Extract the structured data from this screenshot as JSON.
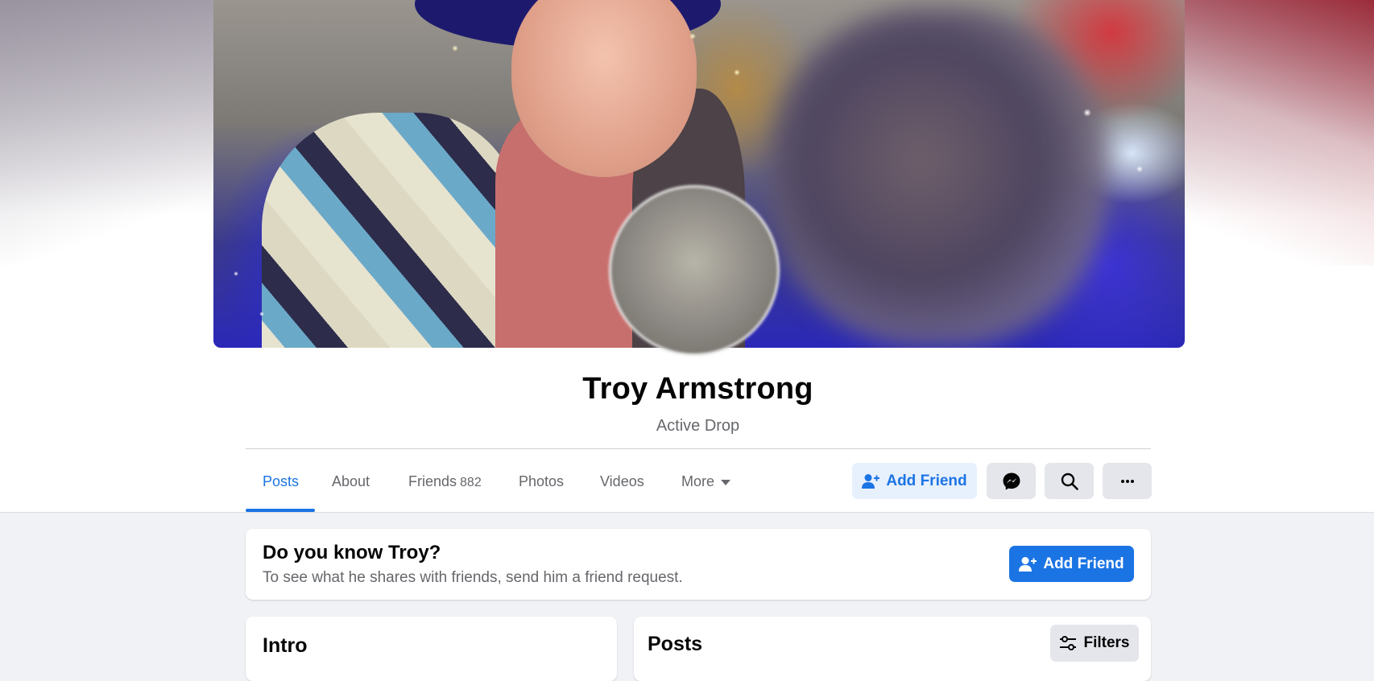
{
  "profile": {
    "name": "Troy Armstrong",
    "subtitle": "Active Drop"
  },
  "tabs": [
    {
      "label": "Posts",
      "active": true
    },
    {
      "label": "About"
    },
    {
      "label": "Friends",
      "count": "882"
    },
    {
      "label": "Photos"
    },
    {
      "label": "Videos"
    },
    {
      "label": "More"
    }
  ],
  "actions": {
    "add_friend": "Add Friend",
    "messenger_icon": "messenger-icon",
    "search_icon": "search-icon",
    "more_icon": "ellipsis-icon"
  },
  "know_card": {
    "title": "Do you know Troy?",
    "text": "To see what he shares with friends, send him a friend request.",
    "button": "Add Friend"
  },
  "intro": {
    "title": "Intro"
  },
  "posts": {
    "title": "Posts",
    "filters_label": "Filters"
  },
  "colors": {
    "accent": "#1b74e4",
    "accent_light": "#e7f0fd",
    "secondary_button": "#e4e6eb",
    "page_background": "#f0f2f5"
  }
}
